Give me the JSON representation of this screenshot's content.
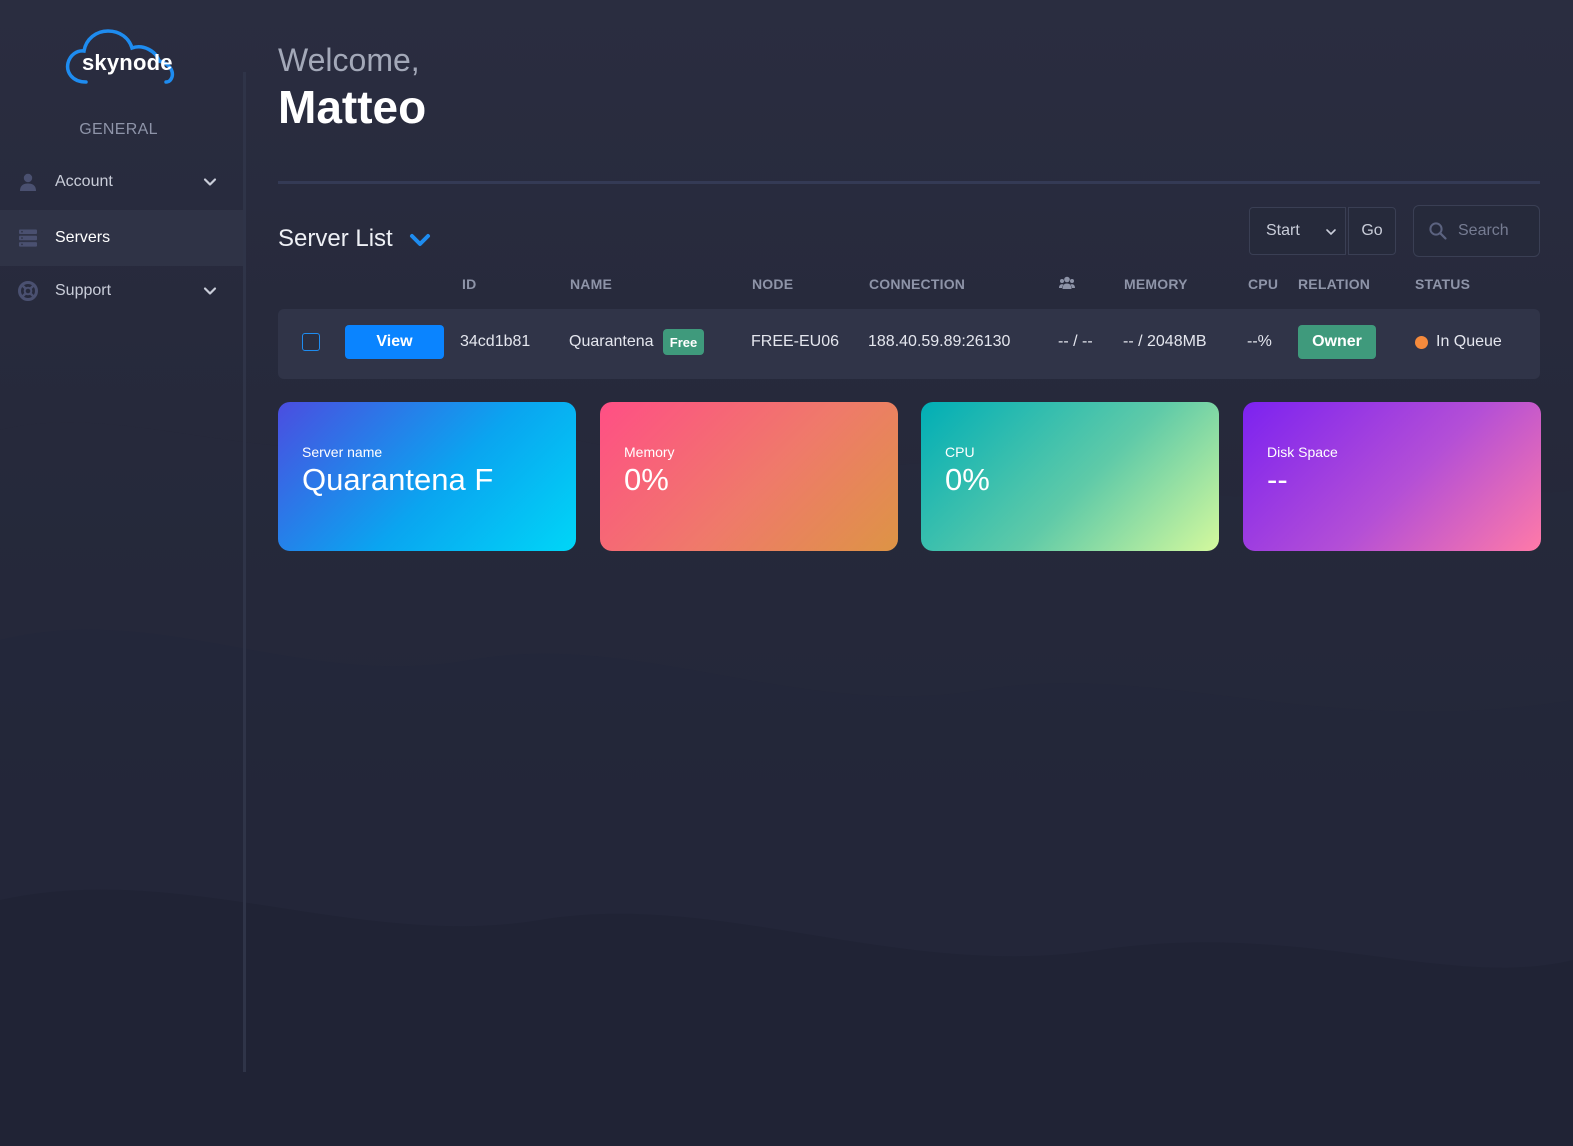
{
  "brand": {
    "name": "skynode",
    "accent": "#1e8cf0"
  },
  "sidebar": {
    "section": "GENERAL",
    "items": [
      {
        "label": "Account",
        "icon": "user-icon",
        "expandable": true,
        "active": false
      },
      {
        "label": "Servers",
        "icon": "servers-icon",
        "expandable": false,
        "active": true
      },
      {
        "label": "Support",
        "icon": "lifebuoy-icon",
        "expandable": true,
        "active": false
      }
    ]
  },
  "header": {
    "greeting": "Welcome,",
    "user": "Matteo"
  },
  "server_list": {
    "title": "Server List",
    "action_select": {
      "selected": "Start"
    },
    "go_label": "Go",
    "search": {
      "placeholder": "Search",
      "value": ""
    },
    "columns": {
      "id": "ID",
      "name": "NAME",
      "node": "NODE",
      "connection": "CONNECTION",
      "players_icon": "users-icon",
      "memory": "MEMORY",
      "cpu": "CPU",
      "relation": "RELATION",
      "status": "STATUS"
    },
    "rows": [
      {
        "view_label": "View",
        "id": "34cd1b81",
        "name": "Quarantena",
        "tier": "Free",
        "node": "FREE-EU06",
        "connection": "188.40.59.89:26130",
        "players": "-- / --",
        "memory": "-- / 2048MB",
        "cpu": "--%",
        "relation": "Owner",
        "status": "In Queue",
        "status_color": "#f58a3c"
      }
    ]
  },
  "cards": [
    {
      "label": "Server name",
      "value": "Quarantena F",
      "gradient": [
        "#4b4de0",
        "#0aa5f0",
        "#00d6f7"
      ]
    },
    {
      "label": "Memory",
      "value": "0%",
      "gradient": [
        "#ff4f85",
        "#ef7a6a",
        "#dd9445"
      ]
    },
    {
      "label": "CPU",
      "value": "0%",
      "gradient": [
        "#00aeb6",
        "#5fcaa8",
        "#d4f99d"
      ]
    },
    {
      "label": "Disk Space",
      "value": "--",
      "gradient": [
        "#7c22f0",
        "#b44fd6",
        "#ff7aa8"
      ]
    }
  ]
}
